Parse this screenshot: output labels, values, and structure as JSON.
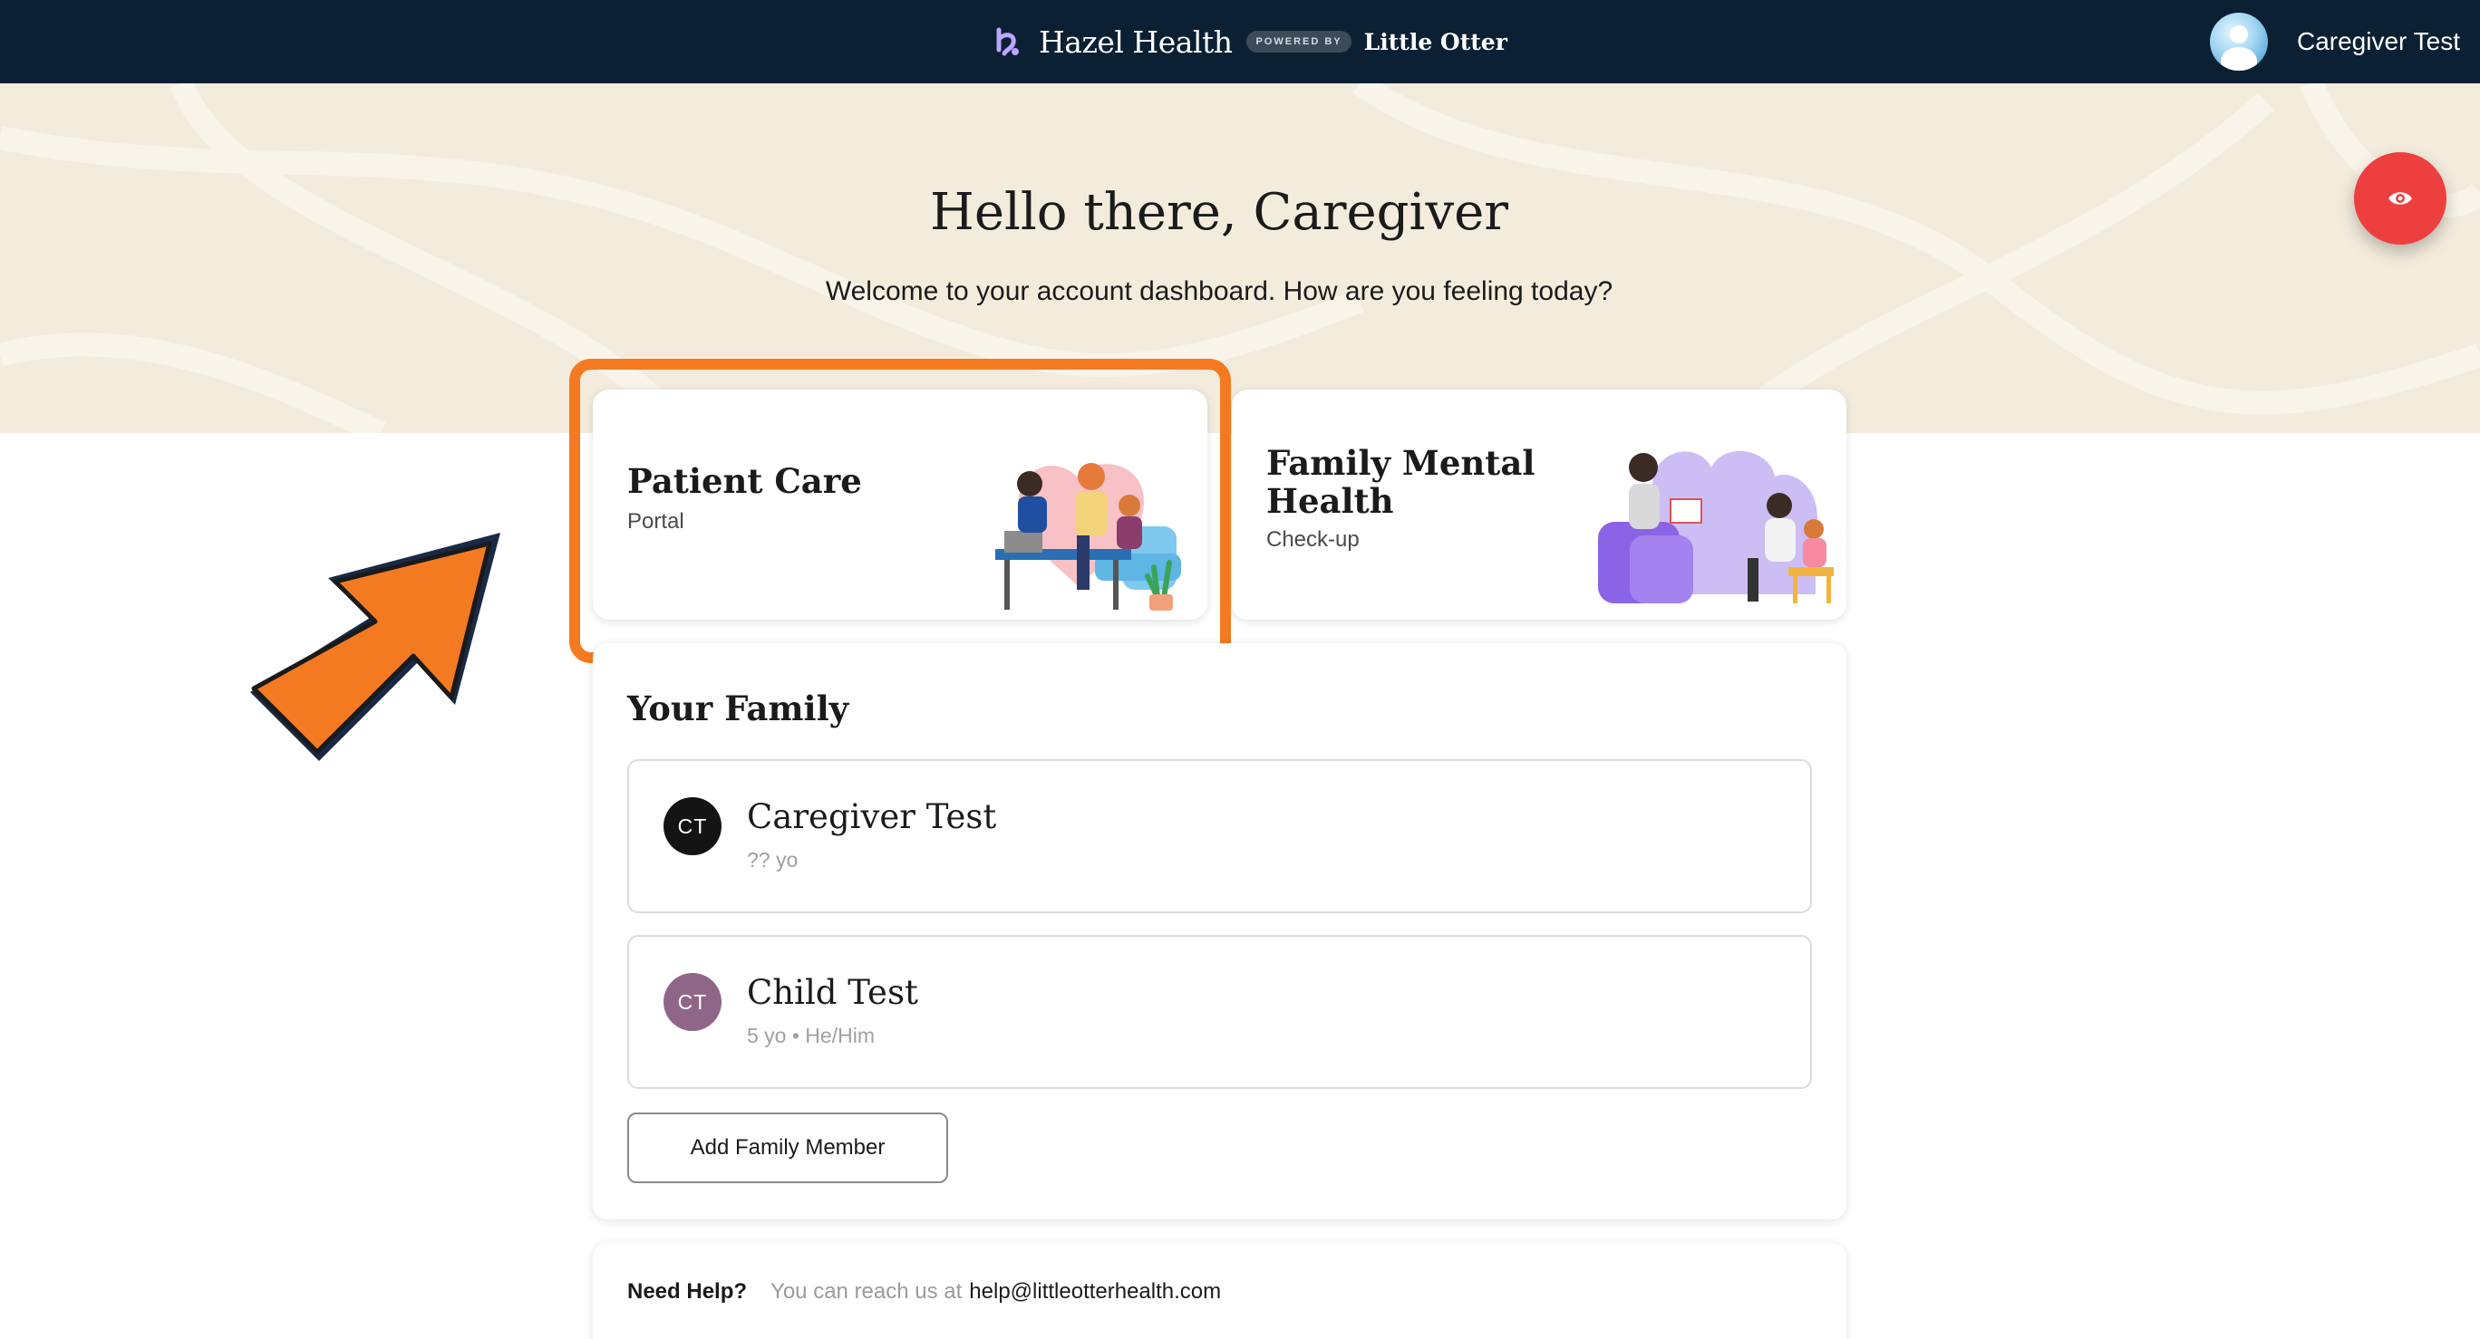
{
  "header": {
    "brand_name": "Hazel Health",
    "powered_by": "POWERED BY",
    "partner_name": "Little Otter",
    "user_name": "Caregiver Test"
  },
  "hero": {
    "title": "Hello there, Caregiver",
    "subtitle": "Welcome to your account dashboard. How are you feeling today?"
  },
  "cards": {
    "patient_care": {
      "title": "Patient Care",
      "subtitle": "Portal"
    },
    "family_mental_health": {
      "title": "Family Mental Health",
      "subtitle": "Check-up"
    }
  },
  "family": {
    "heading": "Your Family",
    "members": [
      {
        "initials": "CT",
        "name": "Caregiver Test",
        "meta": "?? yo"
      },
      {
        "initials": "CT",
        "name": "Child Test",
        "meta": "5 yo • He/Him"
      }
    ],
    "add_button": "Add Family Member"
  },
  "help": {
    "label": "Need Help?",
    "text": "You can reach us at",
    "email": "help@littleotterhealth.com"
  },
  "colors": {
    "topbar": "#0c2034",
    "hero_background": "#f3ecdd",
    "eye_button": "#ee3f3f",
    "highlight": "#f47a22"
  },
  "icons": [
    "hazel-logo-icon",
    "user-avatar-icon",
    "eye-icon",
    "annotation-arrow-icon"
  ]
}
